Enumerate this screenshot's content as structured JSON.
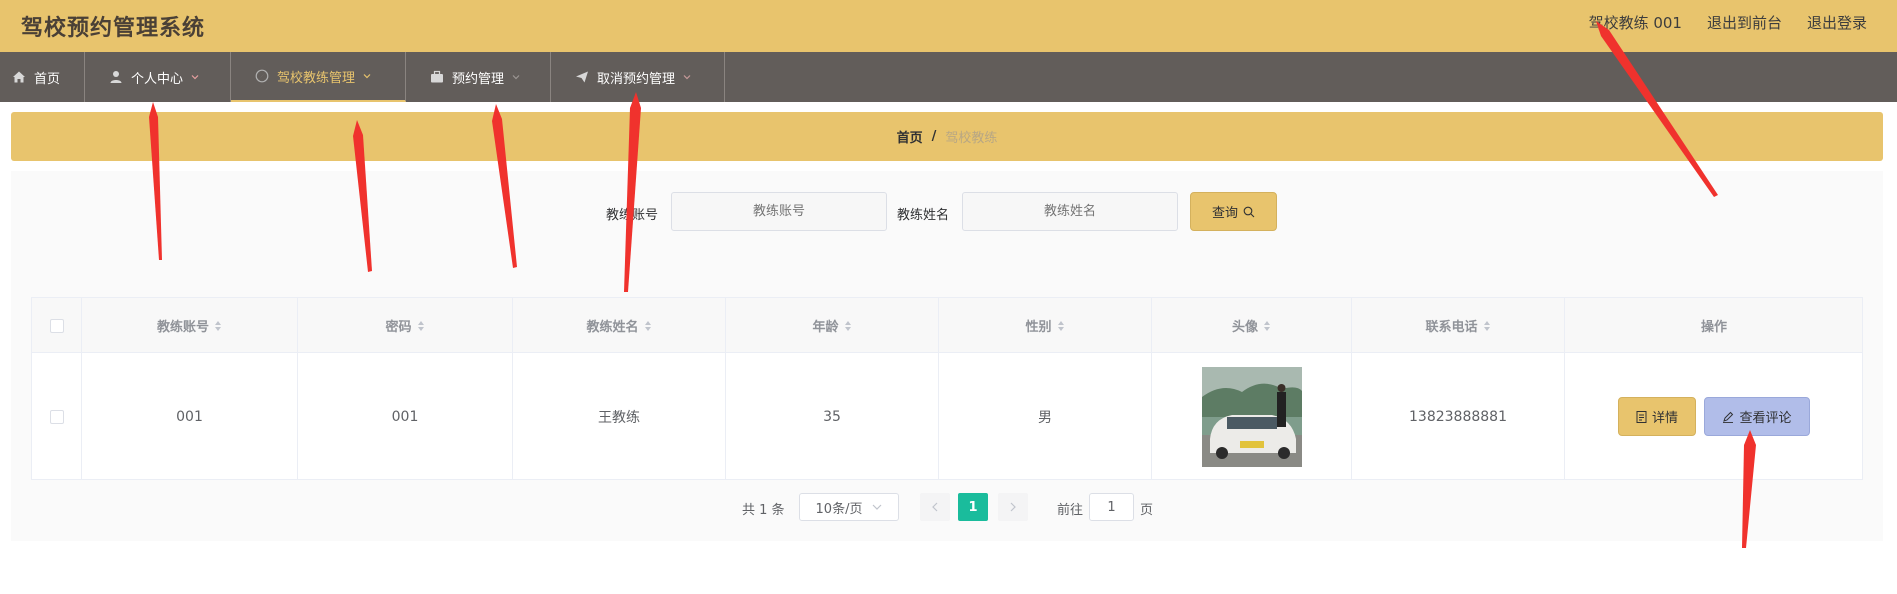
{
  "header": {
    "app_title": "驾校预约管理系统",
    "user_label": "驾校教练 001",
    "back_to_front": "退出到前台",
    "logout": "退出登录"
  },
  "nav": {
    "items": [
      {
        "label": "首页",
        "icon": "home-icon"
      },
      {
        "label": "个人中心",
        "icon": "user-icon"
      },
      {
        "label": "驾校教练管理",
        "icon": "compass-icon"
      },
      {
        "label": "预约管理",
        "icon": "briefcase-icon"
      },
      {
        "label": "取消预约管理",
        "icon": "send-icon"
      }
    ],
    "active_index": 2,
    "active_color": "#e8c46d",
    "bar_color": "#625d5a"
  },
  "breadcrumb": {
    "home": "首页",
    "separator": "/",
    "current": "驾校教练"
  },
  "search": {
    "account_label": "教练账号",
    "account_placeholder": "教练账号",
    "account_value": "",
    "name_label": "教练姓名",
    "name_placeholder": "教练姓名",
    "name_value": "",
    "query_button": "查询"
  },
  "table": {
    "columns": [
      "教练账号",
      "密码",
      "教练姓名",
      "年龄",
      "性别",
      "头像",
      "联系电话",
      "操作"
    ],
    "rows": [
      {
        "account": "001",
        "password": "001",
        "name": "王教练",
        "age": "35",
        "gender": "男",
        "avatar": "car-photo",
        "phone": "13823888881"
      }
    ],
    "detail_button": "详情",
    "comment_button": "查看评论"
  },
  "pagination": {
    "total_text": "共 1 条",
    "page_size": "10条/页",
    "current_page": "1",
    "goto_label": "前往",
    "goto_value": "1",
    "page_unit": "页"
  },
  "colors": {
    "brand": "#e8c46d",
    "accent_green": "#1abc9c",
    "comment_button": "#b1bde9",
    "annotation_arrow": "#f0322d"
  }
}
